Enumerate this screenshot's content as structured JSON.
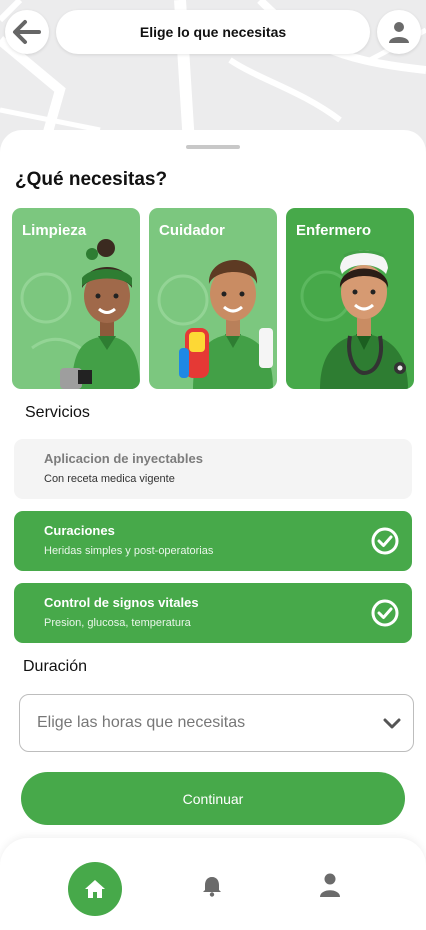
{
  "header": {
    "title": "Elige lo que necesitas",
    "back_icon": "arrow-left-icon",
    "profile_icon": "user-icon"
  },
  "question": "¿Qué necesitas?",
  "categories": [
    {
      "label": "Limpieza",
      "selected": false
    },
    {
      "label": "Cuidador",
      "selected": false
    },
    {
      "label": "Enfermero",
      "selected": true
    }
  ],
  "services_label": "Servicios",
  "services": [
    {
      "title": "Aplicacion de inyectables",
      "subtitle": "Con receta medica vigente",
      "selected": false
    },
    {
      "title": "Curaciones",
      "subtitle": "Heridas simples y post-operatorias",
      "selected": true
    },
    {
      "title": "Control de signos vitales",
      "subtitle": "Presion, glucosa, temperatura",
      "selected": true
    }
  ],
  "duration_label": "Duración",
  "duration_select": {
    "placeholder": "Elige las horas que necesitas"
  },
  "continue_label": "Continuar",
  "bottom_nav": [
    {
      "icon": "home-icon",
      "active": true
    },
    {
      "icon": "bell-icon",
      "active": false
    },
    {
      "icon": "user-icon",
      "active": false
    }
  ],
  "colors": {
    "accent": "#47a94a",
    "accent_light": "#7cc77f",
    "muted_card": "#f4f4f4"
  }
}
